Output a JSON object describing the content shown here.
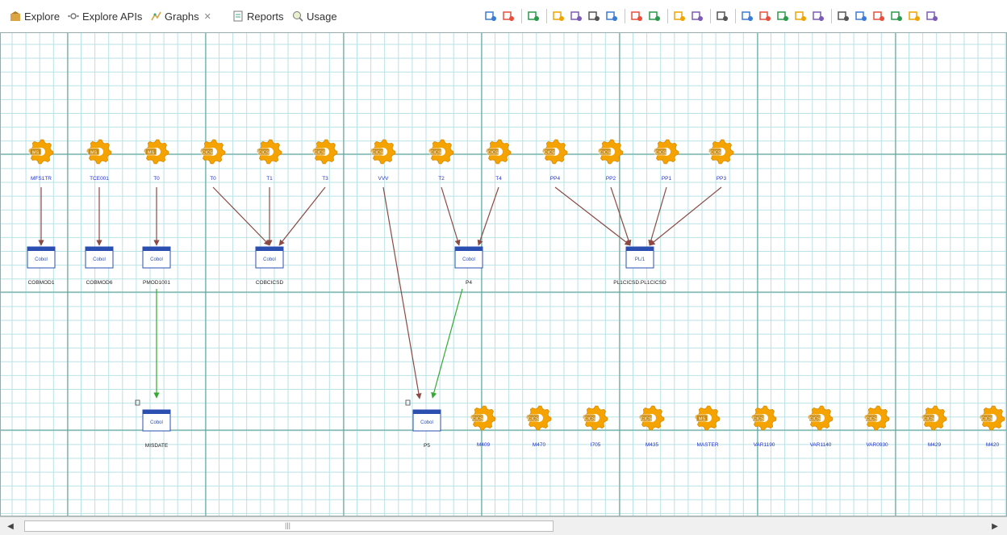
{
  "tabs": [
    {
      "label": "Explore",
      "icon": "explore-icon"
    },
    {
      "label": "Explore APIs",
      "icon": "api-icon"
    },
    {
      "label": "Graphs",
      "icon": "graph-icon",
      "active": true,
      "close": "✕"
    },
    {
      "label": "Reports",
      "icon": "report-icon"
    },
    {
      "label": "Usage",
      "icon": "usage-icon"
    }
  ],
  "toolbar_icons": [
    "expand-icon",
    "collapse-icon",
    "sep",
    "color-grid-icon",
    "sep",
    "remove-link-icon",
    "hide-link-icon",
    "filter-icon",
    "delete-icon",
    "sep",
    "fit-icon",
    "layout-icon",
    "sep",
    "undo-icon",
    "redo-icon",
    "sep",
    "search-icon",
    "sep",
    "pointer-icon",
    "hand-icon",
    "zoom-out-icon",
    "zoom-in-icon",
    "move-icon",
    "sep",
    "select-tool-icon",
    "link-tool-icon",
    "settings-icon",
    "grid-icon",
    "more-icon",
    "minimize-icon"
  ],
  "colors": {
    "grid_major": "#5a9e8e",
    "grid_minor": "#b9e2e6",
    "gear": "#f5a300",
    "link": "#8b4a43",
    "flow": "#33aa33",
    "node_label": "#2233cc"
  },
  "gear_nodes": [
    {
      "tag": "MS",
      "label": "MFS1TR"
    },
    {
      "tag": "MS",
      "label": "TCE001"
    },
    {
      "tag": "MS",
      "label": "T0"
    },
    {
      "tag": "CICS",
      "label": "T0"
    },
    {
      "tag": "CICS",
      "label": "T1"
    },
    {
      "tag": "CICS",
      "label": "T3"
    },
    {
      "tag": "CICS",
      "label": "VVV"
    },
    {
      "tag": "CICS",
      "label": "T2"
    },
    {
      "tag": "CICS",
      "label": "T4"
    },
    {
      "tag": "CICS",
      "label": "PP4"
    },
    {
      "tag": "CICS",
      "label": "PP2"
    },
    {
      "tag": "CICS",
      "label": "PP1"
    },
    {
      "tag": "CICS",
      "label": "PP3"
    }
  ],
  "program_nodes": [
    {
      "lang": "Cobol",
      "label": "COBMOD1"
    },
    {
      "lang": "Cobol",
      "label": "COBMOD6"
    },
    {
      "lang": "Cobol",
      "label": "PMOD1001"
    },
    {
      "lang": "Cobol",
      "label": "COBCICSD"
    },
    {
      "lang": "Cobol",
      "label": "P4"
    },
    {
      "lang": "PL/1",
      "label": "PL1CICSD.PL1CICSD"
    }
  ],
  "bottom_programs": [
    {
      "lang": "Cobol",
      "label": "MISDATE"
    },
    {
      "lang": "Cobol",
      "label": "P5"
    }
  ],
  "bottom_gears": [
    {
      "tag": "CICS",
      "label": "M409"
    },
    {
      "tag": "CICS",
      "label": "M470"
    },
    {
      "tag": "CICS",
      "label": "I705"
    },
    {
      "tag": "CICS",
      "label": "M435"
    },
    {
      "tag": "MS",
      "label": "MASTER"
    },
    {
      "tag": "CICS",
      "label": "VAR1190"
    },
    {
      "tag": "CICS",
      "label": "VAR1140"
    },
    {
      "tag": "CICS",
      "label": "VAR0930"
    },
    {
      "tag": "CICS",
      "label": "M429"
    },
    {
      "tag": "CICS",
      "label": "M420"
    }
  ],
  "scrollbar": {
    "left": "◀",
    "right": "▶",
    "grip": "|||"
  }
}
